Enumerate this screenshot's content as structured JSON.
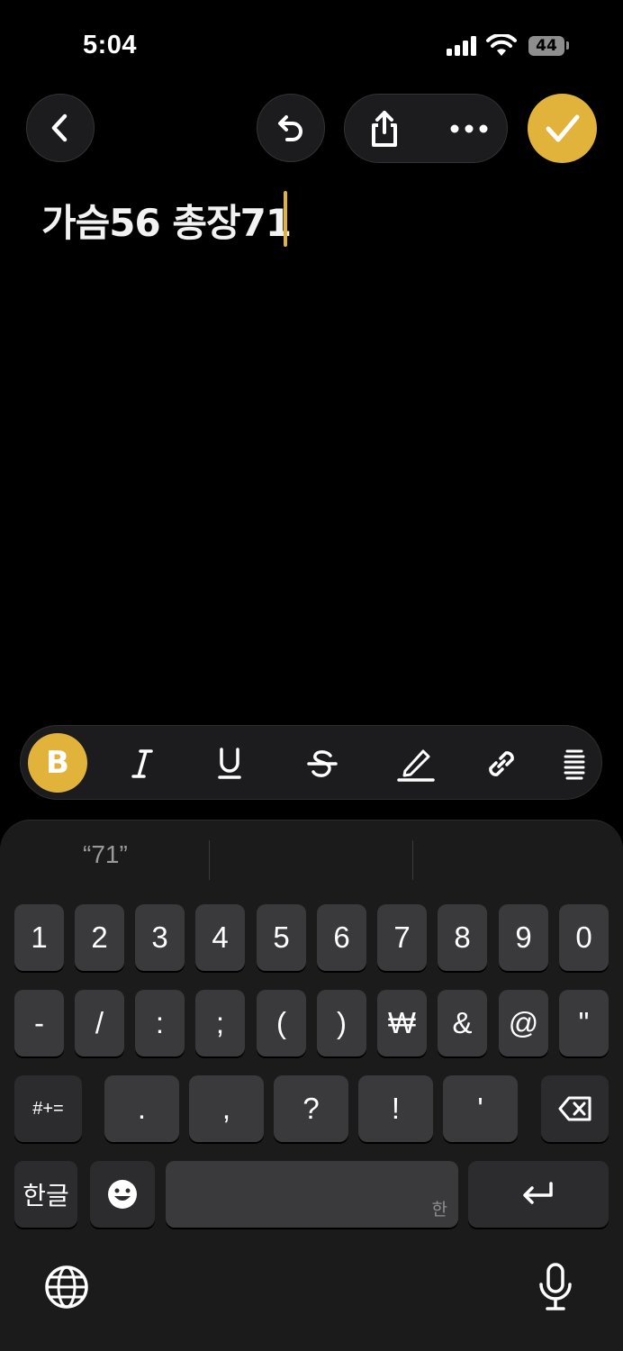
{
  "status": {
    "time": "5:04",
    "battery": "44"
  },
  "note": {
    "text": "가슴56 총장71"
  },
  "keyboard": {
    "suggestion": "“71”",
    "row1": [
      "1",
      "2",
      "3",
      "4",
      "5",
      "6",
      "7",
      "8",
      "9",
      "0"
    ],
    "row2": [
      "-",
      "/",
      ":",
      ";",
      "(",
      ")",
      "₩",
      "&",
      "@",
      "\""
    ],
    "row3": [
      ".",
      ",",
      "?",
      "!",
      "'"
    ],
    "symbols_label": "#+=",
    "lang_label": "한글",
    "space_hint": "한"
  },
  "colors": {
    "accent": "#e2b33b",
    "background": "#000000",
    "key": "#3a3a3c"
  }
}
